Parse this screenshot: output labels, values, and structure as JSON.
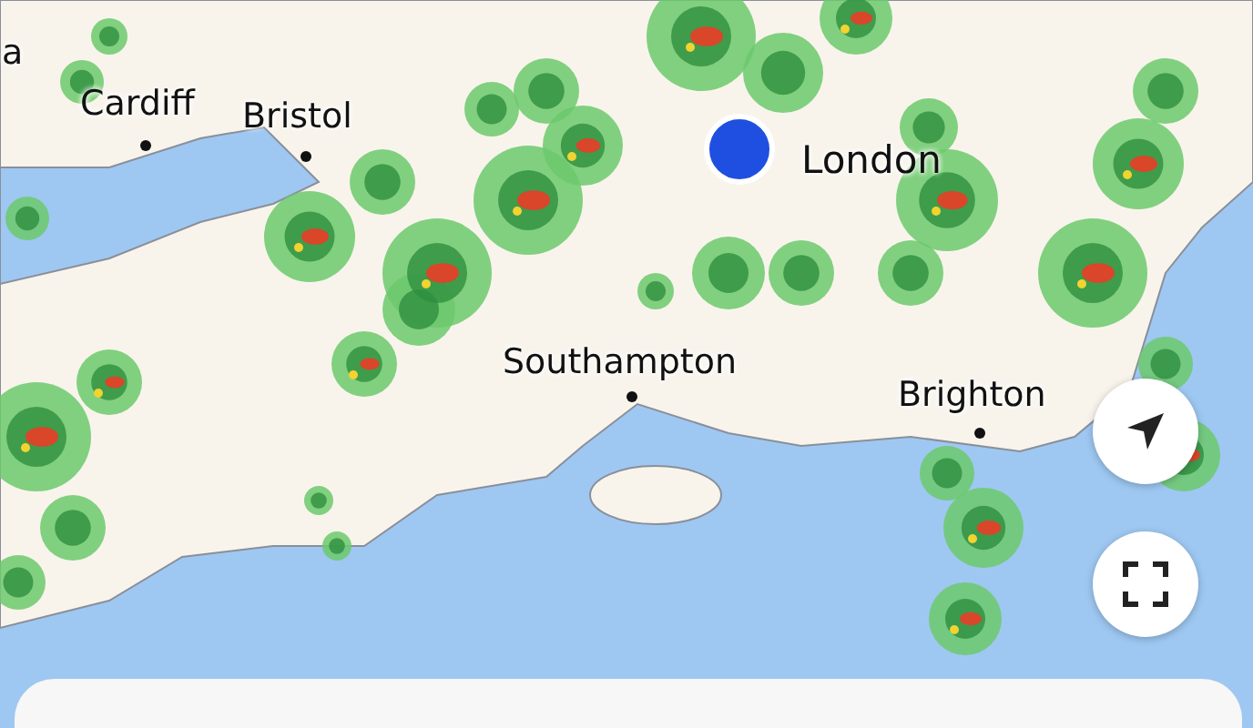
{
  "map": {
    "places": [
      {
        "name": "a",
        "dot": false
      },
      {
        "name": "Cardiff",
        "dot": true
      },
      {
        "name": "Bristol",
        "dot": true
      },
      {
        "name": "London",
        "dot": false
      },
      {
        "name": "Southampton",
        "dot": true
      },
      {
        "name": "Brighton",
        "dot": true
      }
    ]
  }
}
